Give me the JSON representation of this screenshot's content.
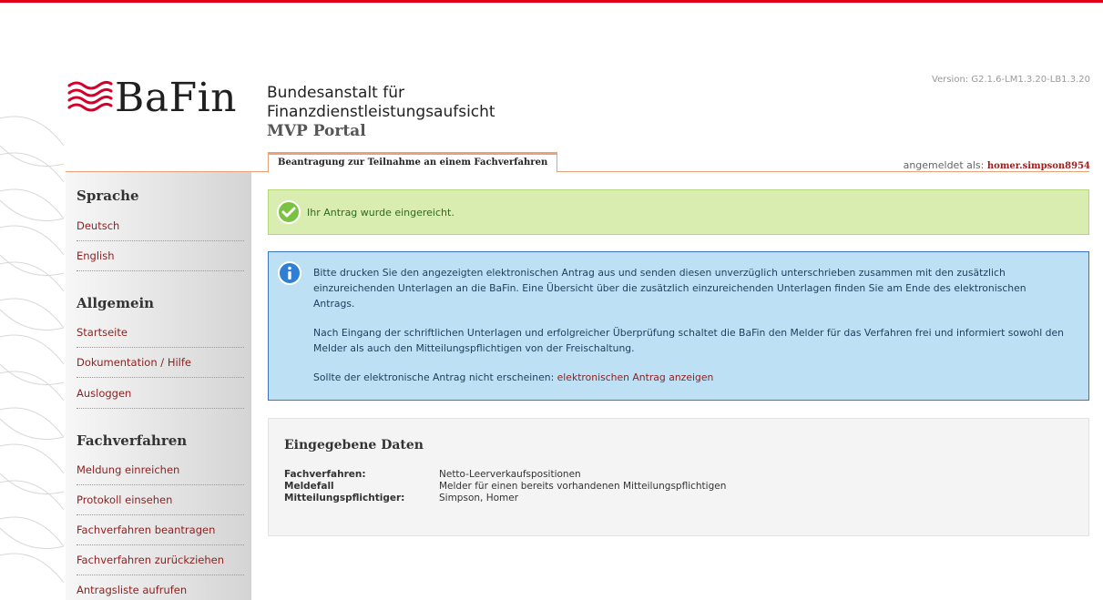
{
  "header": {
    "logo_text": "BaFin",
    "institution": [
      "Bundesanstalt für",
      "Finanzdienstleistungsaufsicht"
    ],
    "portal": "MVP Portal",
    "version": "Version: G2.1.6-LM1.3.20-LB1.3.20",
    "active_tab": "Beantragung zur Teilnahme an einem Fachverfahren",
    "login_label": "angemeldet als:",
    "login_user": "homer.simpson8954"
  },
  "sidebar": {
    "sections": [
      {
        "title": "Sprache",
        "items": [
          "Deutsch",
          "English"
        ]
      },
      {
        "title": "Allgemein",
        "items": [
          "Startseite",
          "Dokumentation / Hilfe",
          "Ausloggen"
        ]
      },
      {
        "title": "Fachverfahren",
        "items": [
          "Meldung einreichen",
          "Protokoll einsehen",
          "Fachverfahren beantragen",
          "Fachverfahren zurückziehen",
          "Antragsliste aufrufen"
        ]
      }
    ]
  },
  "success": {
    "message": "Ihr Antrag wurde eingereicht."
  },
  "info": {
    "para1": "Bitte drucken Sie den angezeigten elektronischen Antrag aus und senden diesen unverzüglich unterschrieben zusammen mit den zusätzlich einzureichenden Unterlagen an die BaFin. Eine Übersicht über die zusätzlich einzureichenden Unterlagen finden Sie am Ende des elektronischen Antrags.",
    "para2": "Nach Eingang der schriftlichen Unterlagen und erfolgreicher Überprüfung schaltet die BaFin den Melder für das Verfahren frei und informiert sowohl den Melder als auch den Mitteilungspflichtigen von der Freischaltung.",
    "para3_prefix": "Sollte der elektronische Antrag nicht erscheinen:",
    "para3_link": "elektronischen Antrag anzeigen"
  },
  "data_box": {
    "title": "Eingegebene Daten",
    "rows": [
      {
        "key": "Fachverfahren:",
        "value": "Netto-Leerverkaufspositionen"
      },
      {
        "key": "Meldefall",
        "value": "Melder für einen bereits vorhandenen Mitteilungspflichtigen"
      },
      {
        "key": "Mitteilungspflichtiger:",
        "value": "Simpson, Homer"
      }
    ]
  },
  "colors": {
    "brand_red": "#e2001a",
    "link": "#8c1f1f",
    "accent_orange": "#e8a27a",
    "success_bg": "#d9edb0",
    "info_bg": "#bde0f4"
  }
}
